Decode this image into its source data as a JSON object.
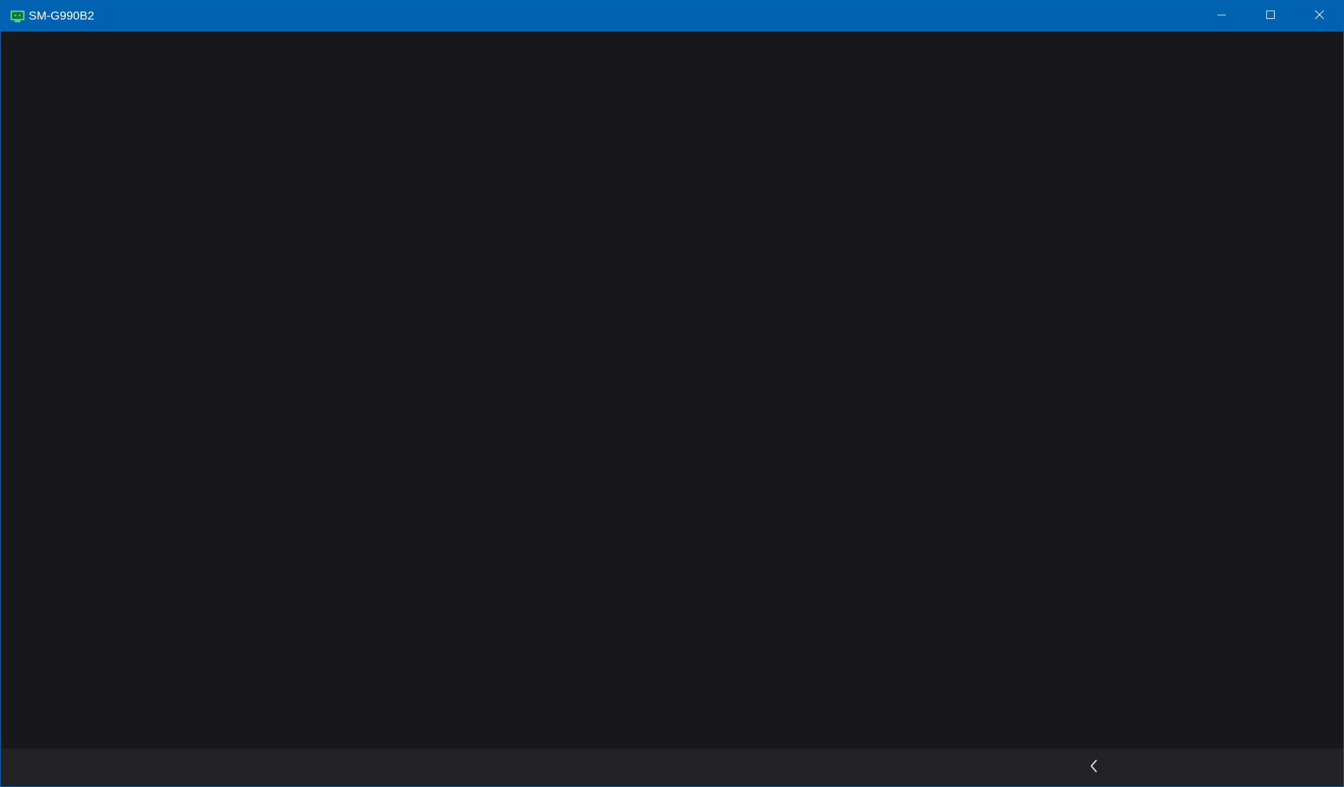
{
  "window": {
    "title": "SM-G990B2",
    "app_icon": "android-mirror-icon",
    "accent_color": "#0063b1",
    "background_color": "#18181a"
  },
  "caption_buttons": {
    "minimize_icon": "minimize-icon",
    "maximize_icon": "maximize-icon",
    "close_icon": "close-icon"
  },
  "navigation_bar": {
    "back_icon": "back-chevron-icon"
  }
}
